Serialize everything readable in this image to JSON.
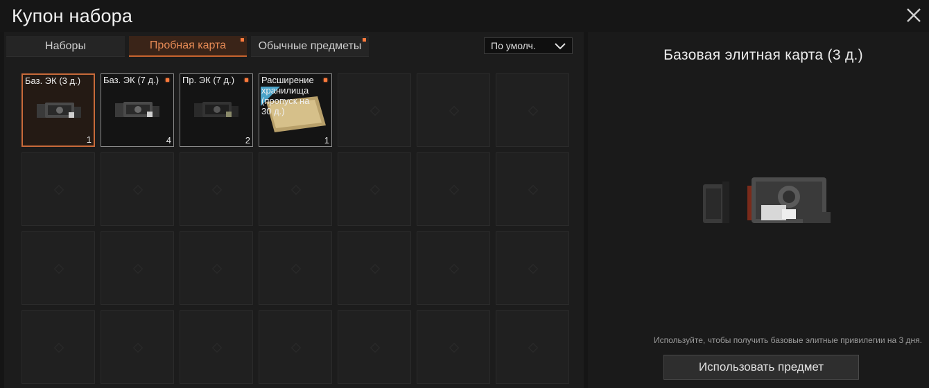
{
  "window": {
    "title": "Купон набора",
    "close_icon": "close-icon"
  },
  "tabs": [
    {
      "label": "Наборы",
      "active": false,
      "has_dot": false
    },
    {
      "label": "Пробная карта",
      "active": true,
      "has_dot": true
    },
    {
      "label": "Обычные предметы",
      "active": false,
      "has_dot": true
    }
  ],
  "sort": {
    "value": "По умолч."
  },
  "items": [
    {
      "name": "Баз. ЭК (3 д.)",
      "count": "1",
      "icon": "elite-card-case-icon",
      "selected": true,
      "has_dot": false
    },
    {
      "name": "Баз. ЭК (7 д.)",
      "count": "4",
      "icon": "elite-card-case-icon",
      "selected": false,
      "has_dot": true
    },
    {
      "name": "Пр. ЭК (7 д.)",
      "count": "2",
      "icon": "elite-card-case-dark-icon",
      "selected": false,
      "has_dot": true
    },
    {
      "name": "Расширение хранилища (пропуск на 30 д.)",
      "count": "1",
      "icon": "storage-pass-ticket-icon",
      "selected": false,
      "has_dot": true
    }
  ],
  "detail": {
    "title": "Базовая элитная карта (3 д.)",
    "description": "Используйте, чтобы получить базовые элитные привилегии на 3 дня.",
    "use_button": "Использовать предмет"
  },
  "colors": {
    "accent": "#c86a3a",
    "dot": "#ff7a3c"
  }
}
